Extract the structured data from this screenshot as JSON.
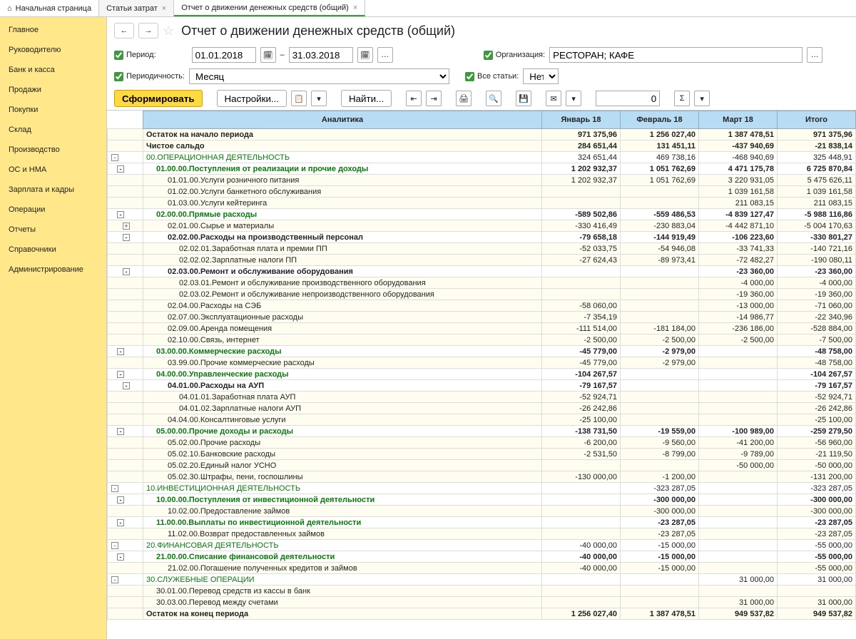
{
  "tabs": [
    {
      "label": "Начальная страница",
      "home": true
    },
    {
      "label": "Статьи затрат",
      "close": true
    },
    {
      "label": "Отчет о движении денежных средств (общий)",
      "close": true,
      "active": true
    }
  ],
  "sidebar": {
    "items": [
      {
        "label": "Главное"
      },
      {
        "label": "Руководителю"
      },
      {
        "label": "Банк и касса"
      },
      {
        "label": "Продажи"
      },
      {
        "label": "Покупки"
      },
      {
        "label": "Склад"
      },
      {
        "label": "Производство"
      },
      {
        "label": "ОС и НМА"
      },
      {
        "label": "Зарплата и кадры"
      },
      {
        "label": "Операции"
      },
      {
        "label": "Отчеты"
      },
      {
        "label": "Справочники"
      },
      {
        "label": "Администрирование"
      }
    ]
  },
  "title": "Отчет о движении денежных средств (общий)",
  "filters": {
    "period_label": "Период:",
    "date_from": "01.01.2018",
    "dash": "–",
    "date_to": "31.03.2018",
    "org_label": "Организация:",
    "org_value": "РЕСТОРАН; КАФЕ",
    "periodicity_label": "Периодичность:",
    "periodicity_value": "Месяц",
    "allarticles_label": "Все статьи:",
    "allarticles_value": "Нет"
  },
  "toolbar": {
    "form": "Сформировать",
    "settings": "Настройки...",
    "find": "Найти...",
    "numbox": "0"
  },
  "columns": {
    "analytics": "Аналитика",
    "jan": "Январь 18",
    "feb": "Февраль 18",
    "mar": "Март 18",
    "total": "Итого"
  },
  "rows": [
    {
      "type": "totalrow",
      "label": "Остаток на начало периода",
      "v": [
        "971 375,96",
        "1 256 027,40",
        "1 387 478,51",
        "971 375,96"
      ]
    },
    {
      "type": "totalrow",
      "label": "Чистое сальдо",
      "v": [
        "284 651,44",
        "131 451,11",
        "-437 940,69",
        "-21 838,14"
      ]
    },
    {
      "type": "l0",
      "toggle": "-",
      "ind": 0,
      "label": "00.ОПЕРАЦИОННАЯ ДЕЯТЕЛЬНОСТЬ",
      "v": [
        "324 651,44",
        "469 738,16",
        "-468 940,69",
        "325 448,91"
      ]
    },
    {
      "type": "l1",
      "toggle": "-",
      "ind": 1,
      "label": "01.00.00.Поступления от реализации и прочие доходы",
      "v": [
        "1 202 932,37",
        "1 051 762,69",
        "4 471 175,78",
        "6 725 870,84"
      ]
    },
    {
      "type": "d",
      "ind": 2,
      "label": "01.01.00.Услуги розничного питания",
      "v": [
        "1 202 932,37",
        "1 051 762,69",
        "3 220 931,05",
        "5 475 626,11"
      ]
    },
    {
      "type": "d",
      "ind": 2,
      "label": "01.02.00.Услуги банкетного обслуживания",
      "v": [
        "",
        "",
        "1 039 161,58",
        "1 039 161,58"
      ]
    },
    {
      "type": "d",
      "ind": 2,
      "label": "01.03.00.Услуги кейтеринга",
      "v": [
        "",
        "",
        "211 083,15",
        "211 083,15"
      ]
    },
    {
      "type": "l1",
      "toggle": "-",
      "ind": 1,
      "label": "02.00.00.Прямые расходы",
      "v": [
        "-589 502,86",
        "-559 486,53",
        "-4 839 127,47",
        "-5 988 116,86"
      ]
    },
    {
      "type": "d",
      "toggle": "+",
      "ind": 2,
      "label": "02.01.00.Сырье и материалы",
      "v": [
        "-330 416,49",
        "-230 883,04",
        "-4 442 871,10",
        "-5 004 170,63"
      ]
    },
    {
      "type": "l2",
      "toggle": "-",
      "ind": 2,
      "label": "02.02.00.Расходы на производственный персонал",
      "v": [
        "-79 658,18",
        "-144 919,49",
        "-106 223,60",
        "-330 801,27"
      ]
    },
    {
      "type": "d",
      "ind": 3,
      "label": "02.02.01.Заработная плата и премии ПП",
      "v": [
        "-52 033,75",
        "-54 946,08",
        "-33 741,33",
        "-140 721,16"
      ]
    },
    {
      "type": "d",
      "ind": 3,
      "label": "02.02.02.Зарплатные налоги ПП",
      "v": [
        "-27 624,43",
        "-89 973,41",
        "-72 482,27",
        "-190 080,11"
      ]
    },
    {
      "type": "l2",
      "toggle": "-",
      "ind": 2,
      "label": "02.03.00.Ремонт и обслуживание оборудования",
      "v": [
        "",
        "",
        "-23 360,00",
        "-23 360,00"
      ]
    },
    {
      "type": "d",
      "ind": 3,
      "label": "02.03.01.Ремонт и обслуживание производственного оборудования",
      "v": [
        "",
        "",
        "-4 000,00",
        "-4 000,00"
      ]
    },
    {
      "type": "d",
      "ind": 3,
      "label": "02.03.02.Ремонт и обслуживание непроизводственного оборудования",
      "v": [
        "",
        "",
        "-19 360,00",
        "-19 360,00"
      ]
    },
    {
      "type": "d",
      "ind": 2,
      "label": "02.04.00.Расходы на СЭБ",
      "v": [
        "-58 060,00",
        "",
        "-13 000,00",
        "-71 060,00"
      ]
    },
    {
      "type": "d",
      "ind": 2,
      "label": "02.07.00.Эксплуатационные расходы",
      "v": [
        "-7 354,19",
        "",
        "-14 986,77",
        "-22 340,96"
      ]
    },
    {
      "type": "d",
      "ind": 2,
      "label": "02.09.00.Аренда помещения",
      "v": [
        "-111 514,00",
        "-181 184,00",
        "-236 186,00",
        "-528 884,00"
      ]
    },
    {
      "type": "d",
      "ind": 2,
      "label": "02.10.00.Связь, интернет",
      "v": [
        "-2 500,00",
        "-2 500,00",
        "-2 500,00",
        "-7 500,00"
      ]
    },
    {
      "type": "l1",
      "toggle": "-",
      "ind": 1,
      "label": "03.00.00.Коммерческие расходы",
      "v": [
        "-45 779,00",
        "-2 979,00",
        "",
        "-48 758,00"
      ]
    },
    {
      "type": "d",
      "ind": 2,
      "label": "03.99.00.Прочие коммерческие расходы",
      "v": [
        "-45 779,00",
        "-2 979,00",
        "",
        "-48 758,00"
      ]
    },
    {
      "type": "l1",
      "toggle": "-",
      "ind": 1,
      "label": "04.00.00.Управленческие расходы",
      "v": [
        "-104 267,57",
        "",
        "",
        "-104 267,57"
      ]
    },
    {
      "type": "l2",
      "toggle": "-",
      "ind": 2,
      "label": "04.01.00.Расходы на АУП",
      "v": [
        "-79 167,57",
        "",
        "",
        "-79 167,57"
      ]
    },
    {
      "type": "d",
      "ind": 3,
      "label": "04.01.01.Заработная плата АУП",
      "v": [
        "-52 924,71",
        "",
        "",
        "-52 924,71"
      ]
    },
    {
      "type": "d",
      "ind": 3,
      "label": "04.01.02.Зарплатные налоги АУП",
      "v": [
        "-26 242,86",
        "",
        "",
        "-26 242,86"
      ]
    },
    {
      "type": "d",
      "ind": 2,
      "label": "04.04.00.Консалтинговые услуги",
      "v": [
        "-25 100,00",
        "",
        "",
        "-25 100,00"
      ]
    },
    {
      "type": "l1",
      "toggle": "-",
      "ind": 1,
      "label": "05.00.00.Прочие доходы и расходы",
      "v": [
        "-138 731,50",
        "-19 559,00",
        "-100 989,00",
        "-259 279,50"
      ]
    },
    {
      "type": "d",
      "ind": 2,
      "label": "05.02.00.Прочие расходы",
      "v": [
        "-6 200,00",
        "-9 560,00",
        "-41 200,00",
        "-56 960,00"
      ]
    },
    {
      "type": "d",
      "ind": 2,
      "label": "05.02.10.Банковские расходы",
      "v": [
        "-2 531,50",
        "-8 799,00",
        "-9 789,00",
        "-21 119,50"
      ]
    },
    {
      "type": "d",
      "ind": 2,
      "label": "05.02.20.Единый налог УСНО",
      "v": [
        "",
        "",
        "-50 000,00",
        "-50 000,00"
      ]
    },
    {
      "type": "d",
      "ind": 2,
      "label": "05.02.30.Штрафы, пени, госпошлины",
      "v": [
        "-130 000,00",
        "-1 200,00",
        "",
        "-131 200,00"
      ]
    },
    {
      "type": "l0",
      "toggle": "-",
      "ind": 0,
      "label": "10.ИНВЕСТИЦИОННАЯ ДЕЯТЕЛЬНОСТЬ",
      "v": [
        "",
        "-323 287,05",
        "",
        "-323 287,05"
      ]
    },
    {
      "type": "l1",
      "toggle": "-",
      "ind": 1,
      "label": "10.00.00.Поступления от инвестиционной деятельности",
      "v": [
        "",
        "-300 000,00",
        "",
        "-300 000,00"
      ]
    },
    {
      "type": "d",
      "ind": 2,
      "label": "10.02.00.Предоставление займов",
      "v": [
        "",
        "-300 000,00",
        "",
        "-300 000,00"
      ]
    },
    {
      "type": "l1",
      "toggle": "-",
      "ind": 1,
      "label": "11.00.00.Выплаты по инвестиционной деятельности",
      "v": [
        "",
        "-23 287,05",
        "",
        "-23 287,05"
      ]
    },
    {
      "type": "d",
      "ind": 2,
      "label": "11.02.00.Возврат предоставленных займов",
      "v": [
        "",
        "-23 287,05",
        "",
        "-23 287,05"
      ]
    },
    {
      "type": "l0",
      "toggle": "-",
      "ind": 0,
      "label": "20.ФИНАНСОВАЯ ДЕЯТЕЛЬНОСТЬ",
      "v": [
        "-40 000,00",
        "-15 000,00",
        "",
        "-55 000,00"
      ]
    },
    {
      "type": "l1",
      "toggle": "-",
      "ind": 1,
      "label": "21.00.00.Списание финансовой деятельности",
      "v": [
        "-40 000,00",
        "-15 000,00",
        "",
        "-55 000,00"
      ]
    },
    {
      "type": "d",
      "ind": 2,
      "label": "21.02.00.Погашение полученных кредитов и займов",
      "v": [
        "-40 000,00",
        "-15 000,00",
        "",
        "-55 000,00"
      ]
    },
    {
      "type": "l0",
      "toggle": "-",
      "ind": 0,
      "label": "30.СЛУЖЕБНЫЕ ОПЕРАЦИИ",
      "v": [
        "",
        "",
        "31 000,00",
        "31 000,00"
      ]
    },
    {
      "type": "d",
      "ind": 1,
      "label": "30.01.00.Перевод средств из кассы в банк",
      "v": [
        "",
        "",
        "",
        ""
      ]
    },
    {
      "type": "d",
      "ind": 1,
      "label": "30.03.00.Перевод между счетами",
      "v": [
        "",
        "",
        "31 000,00",
        "31 000,00"
      ]
    },
    {
      "type": "totalrow",
      "label": "Остаток на конец периода",
      "v": [
        "1 256 027,40",
        "1 387 478,51",
        "949 537,82",
        "949 537,82"
      ]
    }
  ]
}
